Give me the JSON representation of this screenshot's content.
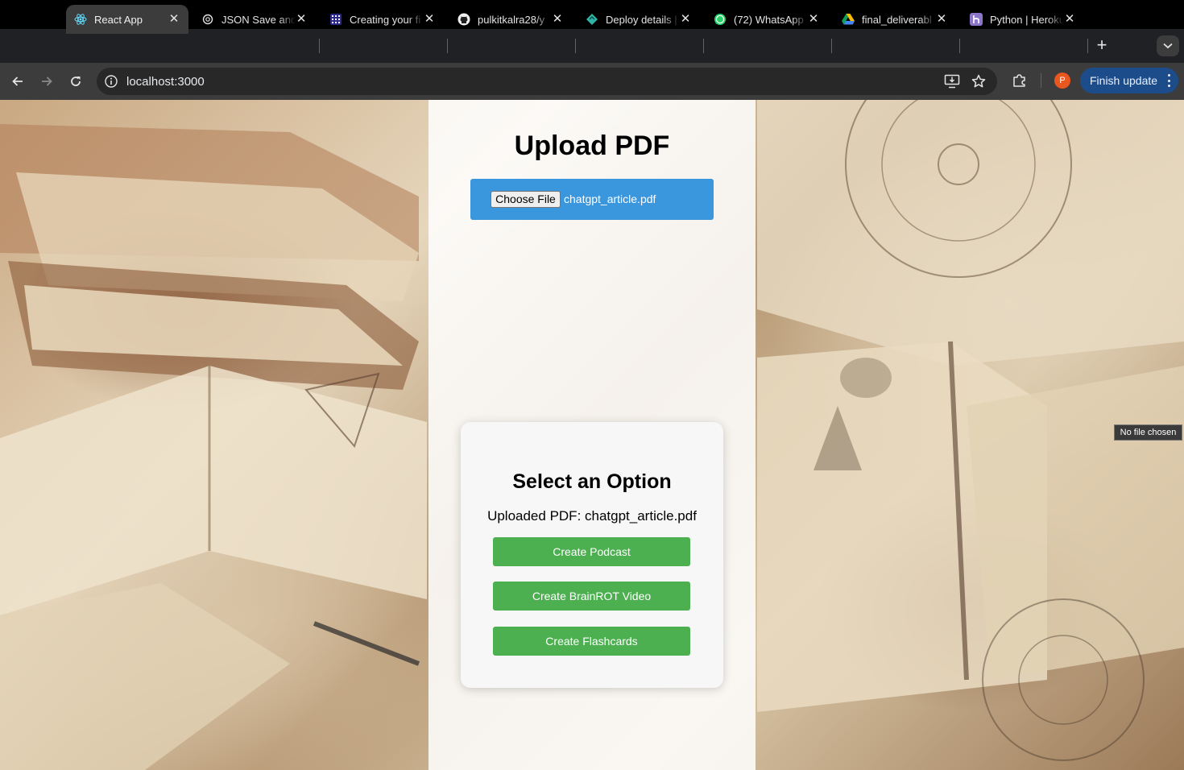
{
  "browser": {
    "tabs": [
      {
        "title": "React App",
        "icon": "react-icon",
        "active": true
      },
      {
        "title": "JSON Save and",
        "icon": "openai-icon",
        "active": false
      },
      {
        "title": "Creating your fi",
        "icon": "grid-app-icon",
        "active": false
      },
      {
        "title": "pulkitkalra28/y",
        "icon": "github-icon",
        "active": false
      },
      {
        "title": "Deploy details |",
        "icon": "netlify-icon",
        "active": false
      },
      {
        "title": "(72) WhatsApp",
        "icon": "whatsapp-icon",
        "active": false
      },
      {
        "title": "final_deliverabl",
        "icon": "google-drive-icon",
        "active": false
      },
      {
        "title": "Python | Heroku",
        "icon": "heroku-icon",
        "active": false
      }
    ],
    "url": "localhost:3000",
    "profile_initial": "P",
    "finish_update_label": "Finish update"
  },
  "upload": {
    "title": "Upload PDF",
    "choose_label": "Choose File",
    "file_name": "chatgpt_article.pdf"
  },
  "options": {
    "title": "Select an Option",
    "uploaded_text": "Uploaded PDF: chatgpt_article.pdf",
    "buttons": [
      "Create Podcast",
      "Create BrainROT Video",
      "Create Flashcards"
    ]
  },
  "tooltip": "No file chosen",
  "colors": {
    "upload_box": "#3a96dd",
    "option_button": "#4caf50",
    "finish_update_bg": "#1c4d8a"
  }
}
